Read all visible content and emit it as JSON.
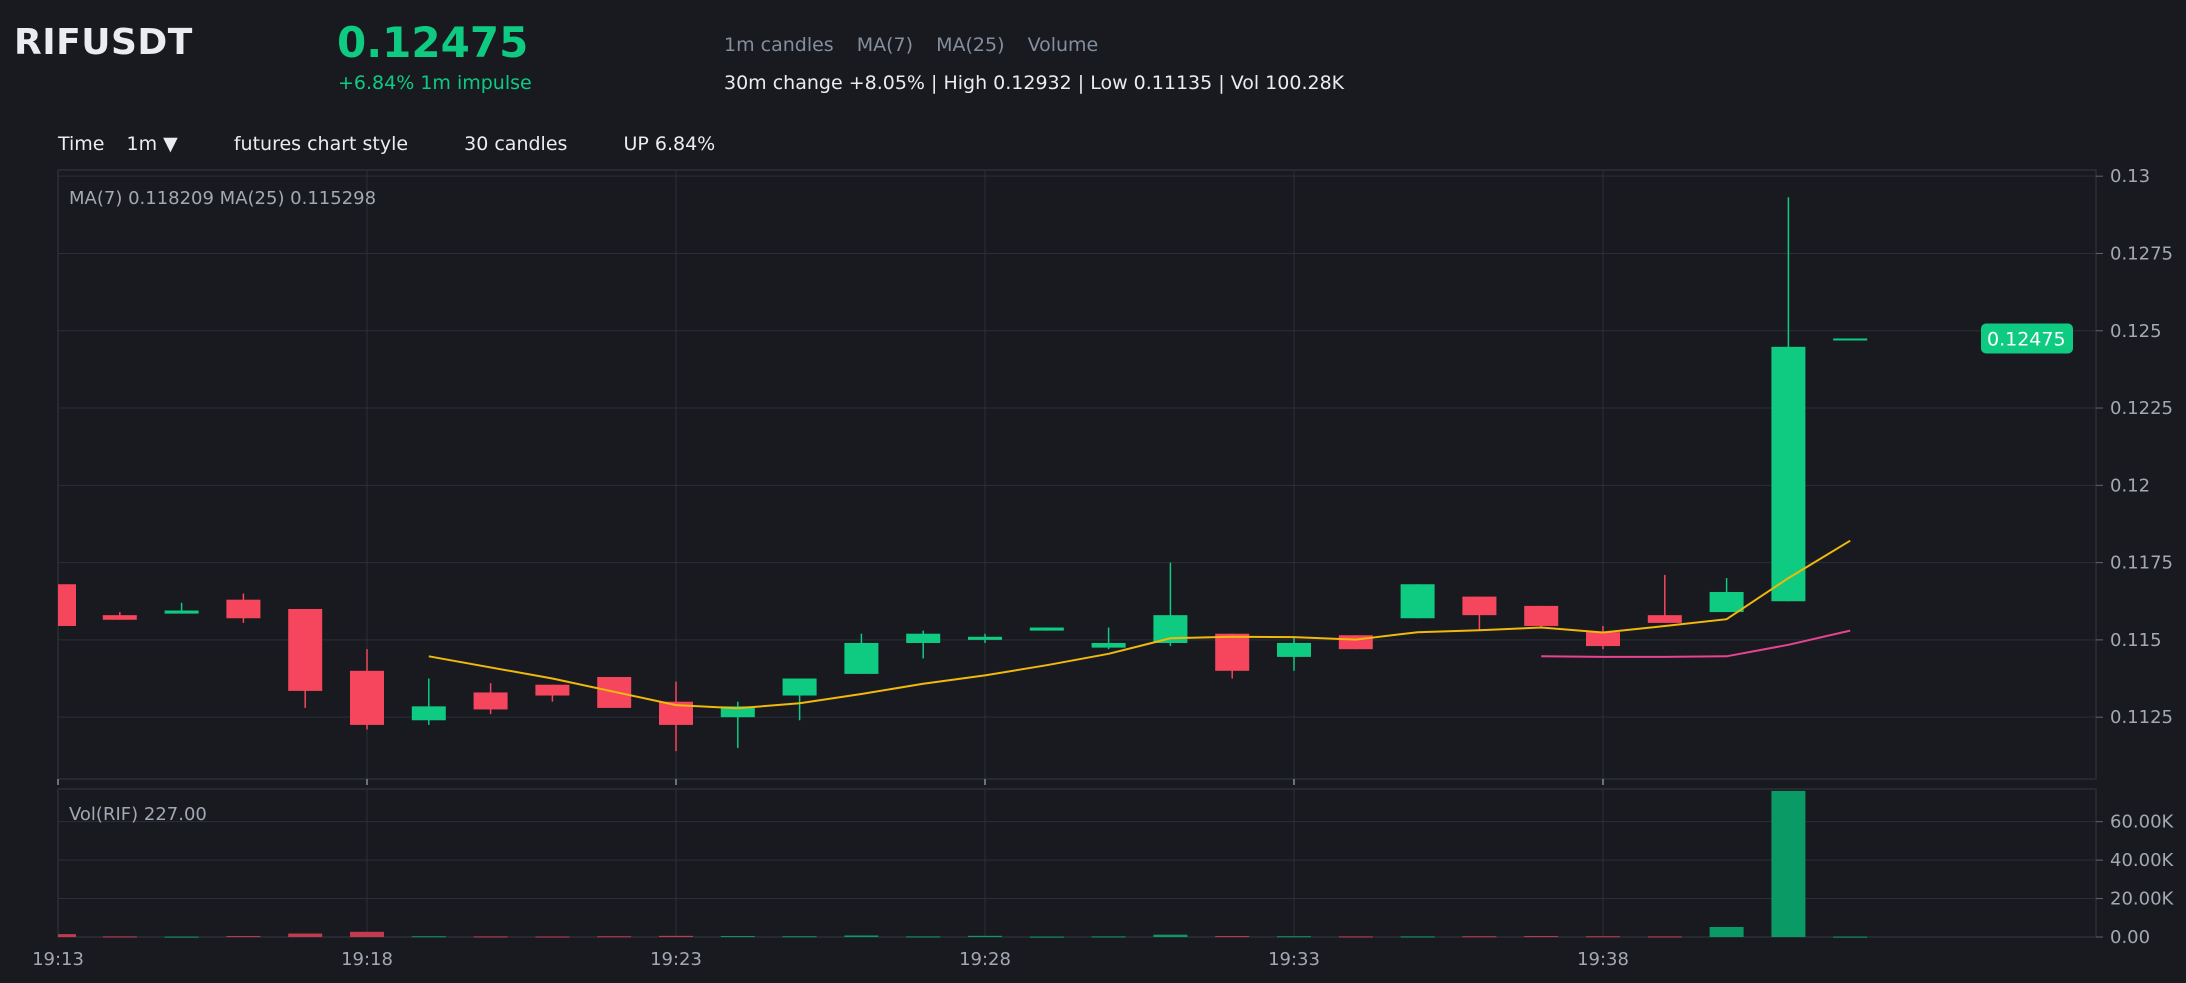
{
  "header": {
    "symbol": "RIFUSDT",
    "price": "0.12475",
    "impulse": "+6.84% 1m impulse",
    "indicators": [
      "1m candles",
      "MA(7)",
      "MA(25)",
      "Volume"
    ],
    "stats": "30m change +8.05% | High 0.12932 | Low 0.11135 | Vol 100.28K"
  },
  "toolbar": {
    "time_label": "Time",
    "interval_label": "1m ▼",
    "style_label": "futures chart style",
    "candles_label": "30 candles",
    "direction_label": "UP 6.84%"
  },
  "colors": {
    "up": "#0ecb81",
    "down": "#f6465d",
    "ma7": "#f0b90b",
    "ma25": "#e84393",
    "background": "#181a20",
    "grid": "#2b2f36"
  },
  "chart_data": {
    "type": "candlestick",
    "price_legend": "MA(7) 0.118209    MA(25) 0.115298",
    "volume_legend": "Vol(RIF) 227.00",
    "last_price_label": "0.12475",
    "x_labels": [
      "19:13",
      "19:18",
      "19:23",
      "19:28",
      "19:33",
      "19:38"
    ],
    "y_ticks": [
      0.1125,
      0.115,
      0.1175,
      0.12,
      0.1225,
      0.125,
      0.1275,
      0.13
    ],
    "y_tick_labels": [
      "0.1125",
      "0.115",
      "0.1175",
      "0.12",
      "0.1225",
      "0.125",
      "0.1275",
      "0.13"
    ],
    "ylim": [
      0.1105,
      0.1302
    ],
    "vol_ticks": [
      0,
      20000,
      40000,
      60000
    ],
    "vol_tick_labels": [
      "0.00",
      "20.00K",
      "40.00K",
      "60.00K"
    ],
    "vol_max": 77000,
    "candles": [
      {
        "t": "19:13",
        "o": 0.1168,
        "h": 0.1168,
        "l": 0.11545,
        "c": 0.11545,
        "v": 1500
      },
      {
        "t": "19:14",
        "o": 0.1158,
        "h": 0.1159,
        "l": 0.11565,
        "c": 0.11565,
        "v": 300
      },
      {
        "t": "19:15",
        "o": 0.11585,
        "h": 0.1162,
        "l": 0.11585,
        "c": 0.11595,
        "v": 200
      },
      {
        "t": "19:16",
        "o": 0.1163,
        "h": 0.1165,
        "l": 0.11555,
        "c": 0.1157,
        "v": 500
      },
      {
        "t": "19:17",
        "o": 0.116,
        "h": 0.116,
        "l": 0.1128,
        "c": 0.11335,
        "v": 1800
      },
      {
        "t": "19:18",
        "o": 0.114,
        "h": 0.1147,
        "l": 0.1121,
        "c": 0.11225,
        "v": 2700
      },
      {
        "t": "19:19",
        "o": 0.1124,
        "h": 0.11375,
        "l": 0.11225,
        "c": 0.11285,
        "v": 400
      },
      {
        "t": "19:20",
        "o": 0.1133,
        "h": 0.1136,
        "l": 0.1126,
        "c": 0.11275,
        "v": 300
      },
      {
        "t": "19:21",
        "o": 0.11355,
        "h": 0.11355,
        "l": 0.113,
        "c": 0.1132,
        "v": 250
      },
      {
        "t": "19:22",
        "o": 0.1138,
        "h": 0.1138,
        "l": 0.1128,
        "c": 0.1128,
        "v": 400
      },
      {
        "t": "19:23",
        "o": 0.113,
        "h": 0.11365,
        "l": 0.1114,
        "c": 0.11225,
        "v": 600
      },
      {
        "t": "19:24",
        "o": 0.1125,
        "h": 0.113,
        "l": 0.1115,
        "c": 0.11285,
        "v": 500
      },
      {
        "t": "19:25",
        "o": 0.1132,
        "h": 0.1132,
        "l": 0.1124,
        "c": 0.11375,
        "v": 400
      },
      {
        "t": "19:26",
        "o": 0.1139,
        "h": 0.1152,
        "l": 0.1139,
        "c": 0.1149,
        "v": 800
      },
      {
        "t": "19:27",
        "o": 0.1149,
        "h": 0.1153,
        "l": 0.1144,
        "c": 0.1152,
        "v": 300
      },
      {
        "t": "19:28",
        "o": 0.115,
        "h": 0.1152,
        "l": 0.1149,
        "c": 0.1151,
        "v": 600
      },
      {
        "t": "19:29",
        "o": 0.1153,
        "h": 0.1154,
        "l": 0.1153,
        "c": 0.1154,
        "v": 200
      },
      {
        "t": "19:30",
        "o": 0.11475,
        "h": 0.1154,
        "l": 0.1147,
        "c": 0.1149,
        "v": 300
      },
      {
        "t": "19:31",
        "o": 0.1149,
        "h": 0.1175,
        "l": 0.1148,
        "c": 0.1158,
        "v": 1200
      },
      {
        "t": "19:32",
        "o": 0.1152,
        "h": 0.1152,
        "l": 0.11375,
        "c": 0.114,
        "v": 500
      },
      {
        "t": "19:33",
        "o": 0.11445,
        "h": 0.1151,
        "l": 0.114,
        "c": 0.1149,
        "v": 400
      },
      {
        "t": "19:34",
        "o": 0.11515,
        "h": 0.11515,
        "l": 0.1147,
        "c": 0.1147,
        "v": 300
      },
      {
        "t": "19:35",
        "o": 0.1157,
        "h": 0.1168,
        "l": 0.1157,
        "c": 0.1168,
        "v": 300
      },
      {
        "t": "19:36",
        "o": 0.1164,
        "h": 0.1164,
        "l": 0.1153,
        "c": 0.1158,
        "v": 400
      },
      {
        "t": "19:37",
        "o": 0.1161,
        "h": 0.1161,
        "l": 0.1154,
        "c": 0.11545,
        "v": 500
      },
      {
        "t": "19:38",
        "o": 0.11525,
        "h": 0.11545,
        "l": 0.1147,
        "c": 0.1148,
        "v": 400
      },
      {
        "t": "19:39",
        "o": 0.1158,
        "h": 0.1171,
        "l": 0.11555,
        "c": 0.11555,
        "v": 300
      },
      {
        "t": "19:40",
        "o": 0.1159,
        "h": 0.117,
        "l": 0.1159,
        "c": 0.11655,
        "v": 5200
      },
      {
        "t": "19:41",
        "o": 0.11625,
        "h": 0.12932,
        "l": 0.11625,
        "c": 0.12448,
        "v": 76000
      },
      {
        "t": "19:42",
        "o": 0.12475,
        "h": 0.12475,
        "l": 0.12475,
        "c": 0.12475,
        "v": 200
      }
    ],
    "ma7": [
      null,
      null,
      null,
      null,
      null,
      null,
      0.11447,
      null,
      0.11375,
      null,
      0.11289,
      0.11279,
      0.11295,
      0.11325,
      0.11358,
      0.11385,
      0.11418,
      0.11455,
      0.11505,
      0.1151,
      0.11509,
      0.11501,
      0.11525,
      0.11531,
      0.1154,
      0.11524,
      0.11545,
      0.11567,
      0.117,
      0.11821
    ],
    "ma25": [
      null,
      null,
      null,
      null,
      null,
      null,
      null,
      null,
      null,
      null,
      null,
      null,
      null,
      null,
      null,
      null,
      null,
      null,
      null,
      null,
      null,
      null,
      null,
      null,
      0.11447,
      0.11445,
      0.11445,
      0.11447,
      0.11484,
      0.1153
    ]
  }
}
